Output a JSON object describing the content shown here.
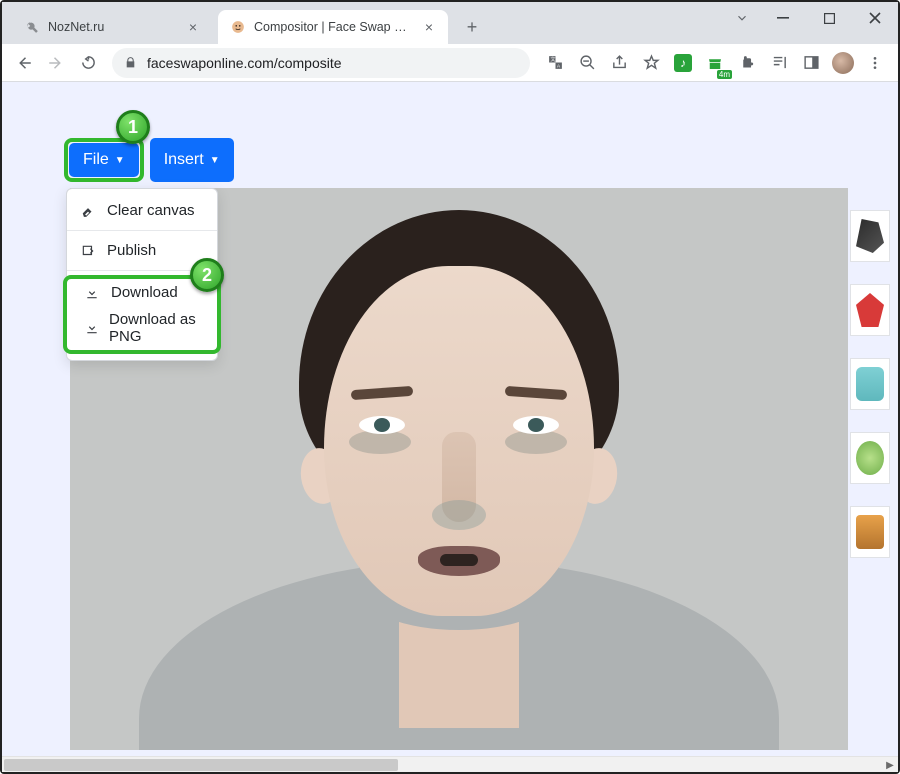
{
  "window": {
    "tabs": [
      {
        "title": "NozNet.ru",
        "active": false
      },
      {
        "title": "Compositor | Face Swap Online",
        "active": true
      }
    ]
  },
  "toolbar": {
    "url": "faceswaponline.com/composite"
  },
  "menu": {
    "file_label": "File",
    "insert_label": "Insert",
    "items": {
      "clear": "Clear canvas",
      "publish": "Publish",
      "download": "Download",
      "download_png": "Download as PNG"
    }
  },
  "callouts": {
    "one": "1",
    "two": "2"
  },
  "ext_badge": "4m"
}
